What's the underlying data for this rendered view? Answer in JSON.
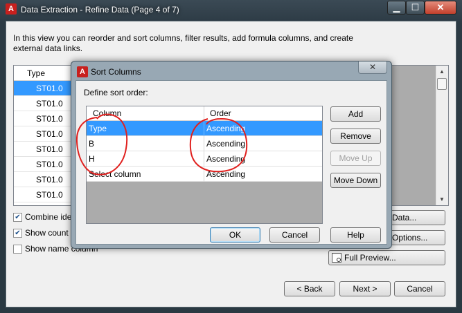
{
  "outer_window": {
    "title": "Data Extraction - Refine Data (Page 4 of 7)",
    "app_icon": "autocad-icon",
    "controls": {
      "minimize": "▁",
      "maximize": "☐",
      "close": "✕"
    },
    "intro_text": "In this view you can reorder and sort columns, filter results, add formula columns, and create external data links.",
    "table": {
      "header": "Type",
      "rows": [
        "ST01.0",
        "ST01.0",
        "ST01.0",
        "ST01.0",
        "ST01.0",
        "ST01.0",
        "ST01.0",
        "ST01.0"
      ],
      "selected_row": 0
    },
    "checkboxes": [
      {
        "label": "Combine identical rows",
        "checked": true
      },
      {
        "label": "Show count column",
        "checked": true
      },
      {
        "label": "Show name column",
        "checked": false
      }
    ],
    "side_buttons": {
      "link_data": "Data...",
      "full_preview": "Full Preview...",
      "options": "Options..."
    },
    "nav_buttons": {
      "back": "< Back",
      "next": "Next >",
      "cancel": "Cancel"
    }
  },
  "sort_dialog": {
    "title": "Sort Columns",
    "close": "✕",
    "define_label": "Define sort order:",
    "columns": {
      "column": "Column",
      "order": "Order"
    },
    "rows": [
      {
        "column": "Type",
        "order": "Ascending",
        "selected": true
      },
      {
        "column": "B",
        "order": "Ascending",
        "selected": false
      },
      {
        "column": "H",
        "order": "Ascending",
        "selected": false
      },
      {
        "column": "Select column",
        "order": "Ascending",
        "selected": false
      }
    ],
    "buttons": {
      "add": "Add",
      "remove": "Remove",
      "move_up": "Move Up",
      "move_down": "Move Down"
    },
    "footer": {
      "ok": "OK",
      "cancel": "Cancel",
      "help": "Help"
    }
  },
  "colors": {
    "selection": "#3399ff",
    "annotation": "#e0201e",
    "title_bar": "#2c3a44"
  }
}
